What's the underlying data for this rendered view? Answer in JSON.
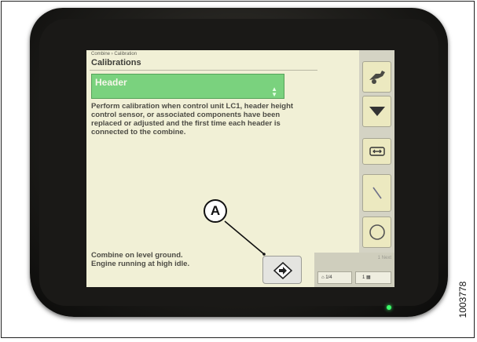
{
  "screen": {
    "breadcrumb": "Combine › Calibration",
    "title": "Calibrations",
    "header_select": {
      "selected": "Header",
      "arrows": "⬍"
    },
    "instructions": "Perform calibration when control unit LC1, header height control sensor, or associated components have been replaced or adjusted and the first time each header is connected to the combine.",
    "status_line_1": "Combine on level ground.",
    "status_line_2": "Engine running at high idle.",
    "calibrate_button": {
      "icon": "diamond-arrow-icon"
    }
  },
  "right_toolbar": {
    "buttons": [
      {
        "icon": "combine-header-icon"
      },
      {
        "icon": "down-arrow-icon"
      },
      {
        "icon": "header-float-icon"
      },
      {
        "icon": "tilt-angle-icon"
      },
      {
        "icon": "circle-icon"
      }
    ]
  },
  "bottom_bar": {
    "label": "1 Next",
    "home_button": "1/4",
    "menu_button": "1"
  },
  "callout": {
    "label": "A"
  },
  "figure_id": "1003778",
  "colors": {
    "bezel": "#1f1e1b",
    "screen_bg": "#f1f0d6",
    "select_green": "#7ad27e",
    "toolbar_bg": "#d4d3c4",
    "led": "#3cff6a"
  }
}
